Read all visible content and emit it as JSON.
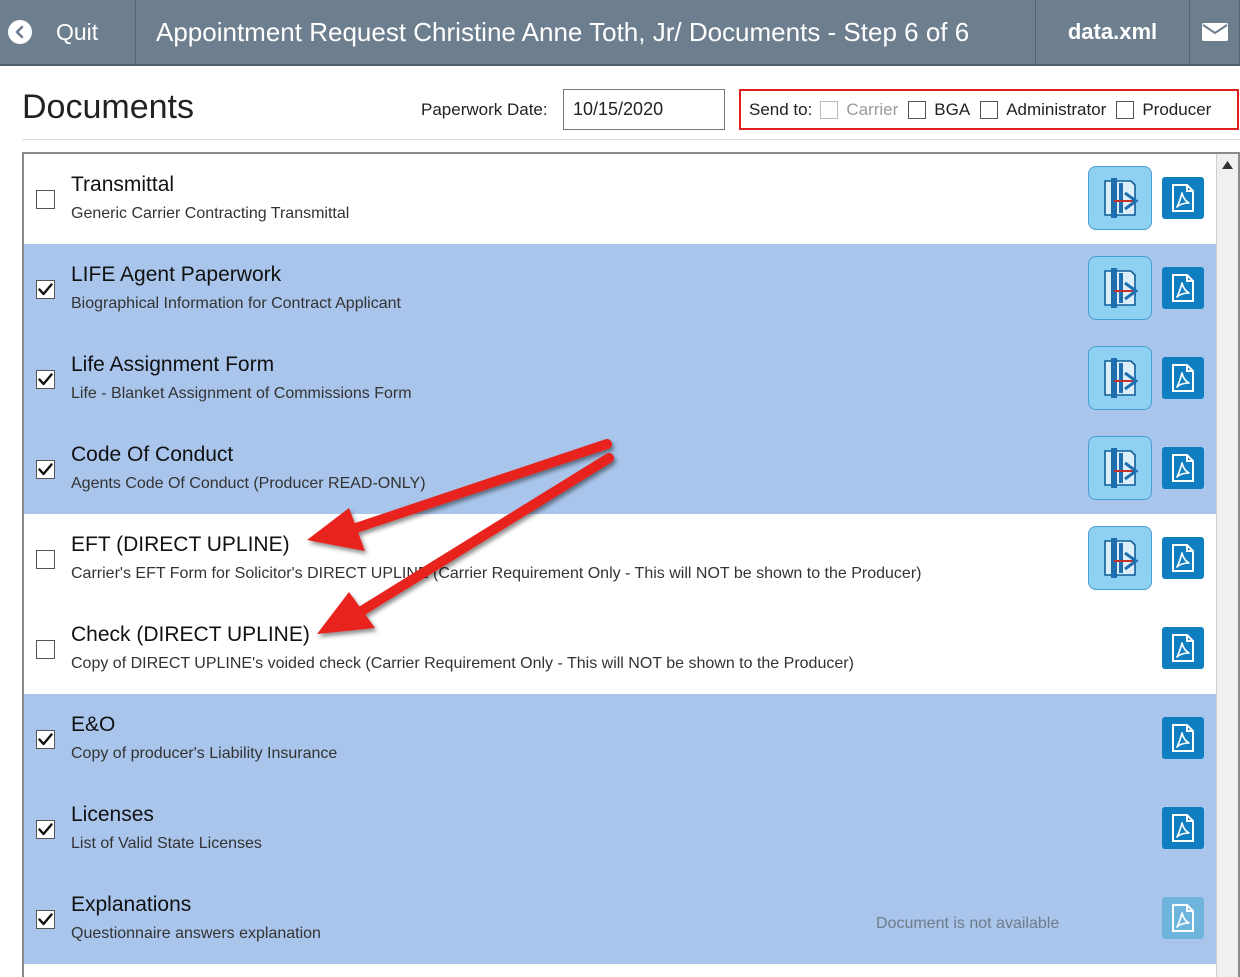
{
  "header": {
    "quit_label": "Quit",
    "title": "Appointment Request Christine Anne Toth, Jr/ Documents - Step 6 of 6",
    "data_xml_label": "data.xml"
  },
  "page": {
    "heading": "Documents",
    "paperwork_date_label": "Paperwork Date:",
    "paperwork_date_value": "10/15/2020"
  },
  "send_to": {
    "label": "Send to:",
    "options": [
      {
        "label": "Carrier",
        "checked": false,
        "disabled": true
      },
      {
        "label": "BGA",
        "checked": false,
        "disabled": false
      },
      {
        "label": "Administrator",
        "checked": false,
        "disabled": false
      },
      {
        "label": "Producer",
        "checked": false,
        "disabled": false
      }
    ]
  },
  "documents": [
    {
      "name": "Transmittal",
      "description": "Generic Carrier Contracting Transmittal",
      "checked": false,
      "editable": true,
      "pdf": true
    },
    {
      "name": "LIFE Agent Paperwork",
      "description": "Biographical Information for Contract Applicant",
      "checked": true,
      "editable": true,
      "pdf": true
    },
    {
      "name": "Life Assignment Form",
      "description": "Life - Blanket Assignment of Commissions Form",
      "checked": true,
      "editable": true,
      "pdf": true
    },
    {
      "name": "Code Of Conduct",
      "description": "Agents Code Of Conduct (Producer READ-ONLY)",
      "checked": true,
      "editable": true,
      "pdf": true
    },
    {
      "name": "EFT (DIRECT UPLINE)",
      "description": "Carrier's EFT Form for Solicitor's DIRECT UPLINE (Carrier Requirement Only - This will NOT be shown to the Producer)",
      "checked": false,
      "editable": true,
      "pdf": true
    },
    {
      "name": "Check (DIRECT UPLINE)",
      "description": "Copy of DIRECT UPLINE's voided check (Carrier Requirement Only - This will NOT be shown to the Producer)",
      "checked": false,
      "editable": false,
      "pdf": true
    },
    {
      "name": "E&O",
      "description": "Copy of producer's Liability Insurance",
      "checked": true,
      "editable": false,
      "pdf": true
    },
    {
      "name": "Licenses",
      "description": "List of Valid State Licenses",
      "checked": true,
      "editable": false,
      "pdf": true
    },
    {
      "name": "Explanations",
      "description": "Questionnaire answers explanation",
      "checked": true,
      "editable": false,
      "pdf": false,
      "status": "Document is not available"
    }
  ],
  "colors": {
    "selected_row": "#a9c5eb",
    "topbar": "#6d7e8f",
    "pdf_button": "#0f7fc2",
    "annotation_arrow": "#e8201b",
    "send_to_border": "#e0201f"
  },
  "icons": {
    "back": "back-circle-icon",
    "mail": "envelope-icon",
    "edit": "form-editor-icon",
    "pdf": "pdf-icon"
  }
}
